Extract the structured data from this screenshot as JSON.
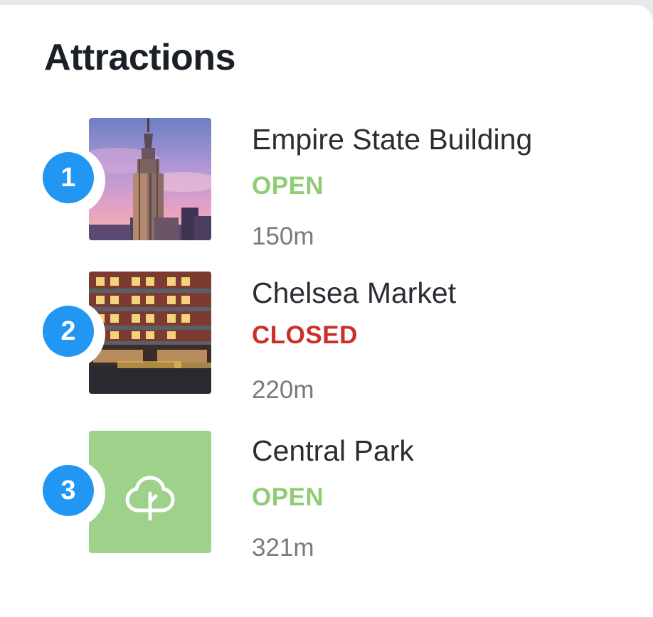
{
  "card": {
    "title": "Attractions"
  },
  "attractions": [
    {
      "number": "1",
      "name": "Empire State Building",
      "status": "OPEN",
      "distance": "150m",
      "image": "empire-state-building-photo"
    },
    {
      "number": "2",
      "name": "Chelsea Market",
      "status": "CLOSED",
      "distance": "220m",
      "image": "chelsea-market-photo"
    },
    {
      "number": "3",
      "name": "Central Park",
      "status": "OPEN",
      "distance": "321m",
      "image": "tree-icon"
    }
  ],
  "colors": {
    "badge": "#2196f3",
    "open": "#8fcc74",
    "closed": "#c9302c",
    "park_tile": "#9ed28a"
  }
}
